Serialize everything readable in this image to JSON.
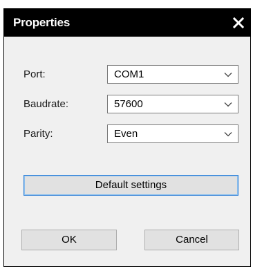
{
  "window": {
    "title": "Properties",
    "close_glyph": "close-icon"
  },
  "fields": [
    {
      "label": "Port:",
      "value": "COM1"
    },
    {
      "label": "Baudrate:",
      "value": "57600"
    },
    {
      "label": "Parity:",
      "value": "Even"
    }
  ],
  "buttons": {
    "default_settings": "Default settings",
    "ok": "OK",
    "cancel": "Cancel"
  },
  "colors": {
    "titlebar": "#000000",
    "window_bg": "#f0f0f0",
    "focus_border": "#2f7fd6"
  }
}
